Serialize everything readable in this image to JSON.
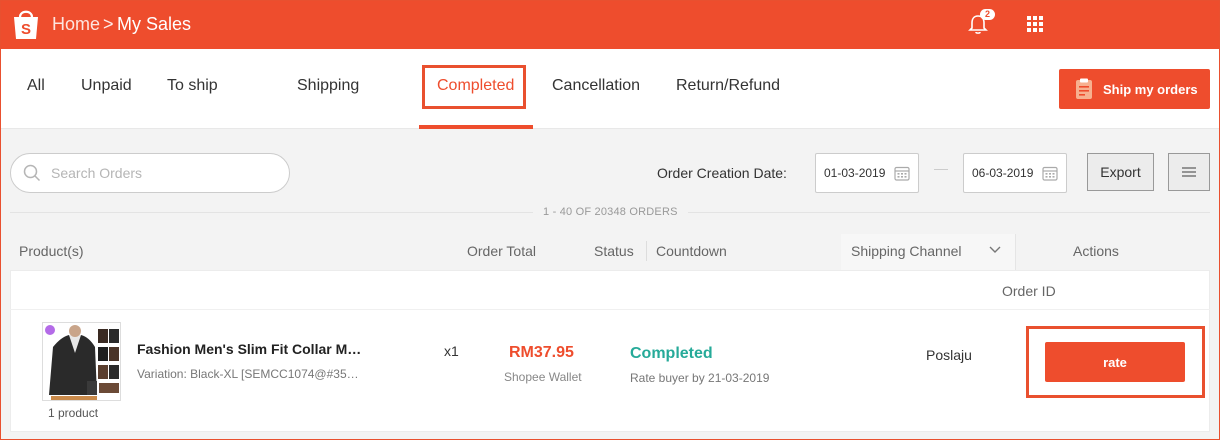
{
  "header": {
    "breadcrumb_home": "Home",
    "breadcrumb_separator": ">",
    "breadcrumb_current": "My Sales",
    "notification_count": "2",
    "icons": {
      "logo": "shopee-bag-icon",
      "bell": "bell-icon",
      "apps": "apps-grid-icon"
    }
  },
  "tabs": [
    {
      "label": "All"
    },
    {
      "label": "Unpaid"
    },
    {
      "label": "To ship"
    },
    {
      "label": "Shipping"
    },
    {
      "label": "Completed",
      "active": true
    },
    {
      "label": "Cancellation"
    },
    {
      "label": "Return/Refund"
    }
  ],
  "ship_button": {
    "label": "Ship my orders",
    "icon": "clipboard-icon"
  },
  "filters": {
    "search_placeholder": "Search Orders",
    "date_label": "Order Creation Date:",
    "date_from": "01-03-2019",
    "date_to": "06-03-2019",
    "export_label": "Export"
  },
  "summary": {
    "count_text": "1 - 40 OF 20348 ORDERS"
  },
  "table": {
    "headers": {
      "products": "Product(s)",
      "order_total": "Order Total",
      "status": "Status",
      "countdown": "Countdown",
      "shipping_channel": "Shipping Channel",
      "actions": "Actions",
      "order_id": "Order ID"
    }
  },
  "order": {
    "product_count": "1 product",
    "product_name": "Fashion Men's Slim Fit Collar Mot...",
    "variation": "Variation: Black-XL [SEMCC1074@#355...",
    "quantity": "x1",
    "total": "RM37.95",
    "payment_method": "Shopee Wallet",
    "status": "Completed",
    "rate_by": "Rate buyer by 21-03-2019",
    "shipping_channel": "Poslaju",
    "action_label": "rate"
  },
  "colors": {
    "brand": "#ee4d2d",
    "status_completed": "#26aa99",
    "highlight_border": "#e9502f"
  }
}
